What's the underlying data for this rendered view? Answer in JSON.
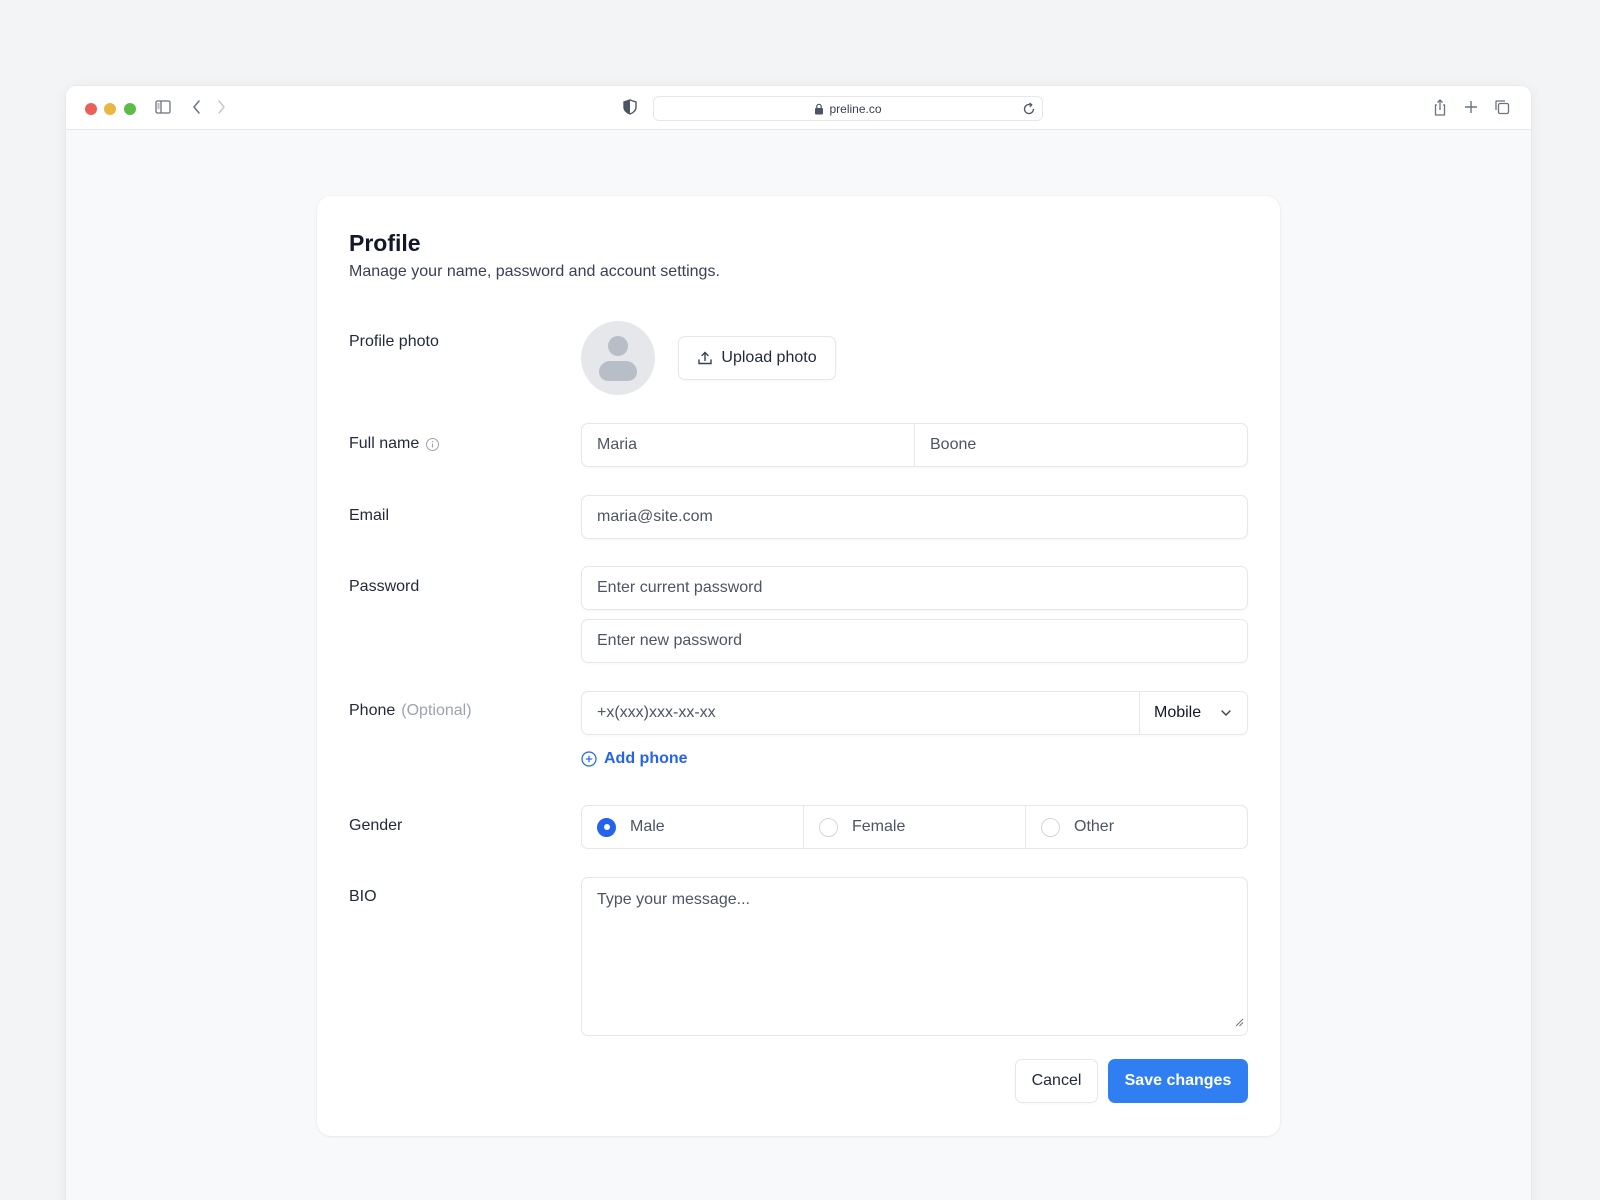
{
  "browser": {
    "url": "preline.co"
  },
  "profile": {
    "title": "Profile",
    "subtitle": "Manage your name, password and account settings.",
    "photo_label": "Profile photo",
    "upload_button": "Upload photo",
    "fullname_label": "Full name",
    "first_name_value": "Maria",
    "last_name_value": "Boone",
    "email_label": "Email",
    "email_value": "maria@site.com",
    "password_label": "Password",
    "current_password_placeholder": "Enter current password",
    "new_password_placeholder": "Enter new password",
    "phone_label": "Phone",
    "phone_optional": "(Optional)",
    "phone_placeholder": "+x(xxx)xxx-xx-xx",
    "phone_type": "Mobile",
    "add_phone": "Add phone",
    "gender_label": "Gender",
    "gender_options": [
      "Male",
      "Female",
      "Other"
    ],
    "gender_selected": "Male",
    "bio_label": "BIO",
    "bio_placeholder": "Type your message...",
    "cancel_button": "Cancel",
    "save_button": "Save changes"
  },
  "colors": {
    "accent": "#2f7ff3",
    "link": "#2563eb"
  }
}
